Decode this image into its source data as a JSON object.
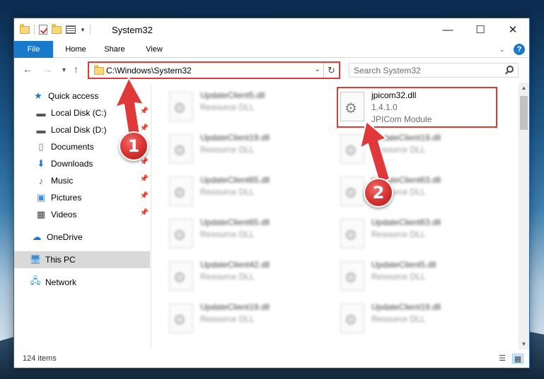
{
  "window": {
    "title": "System32",
    "controls": {
      "minimize": "—",
      "maximize": "☐",
      "close": "✕"
    }
  },
  "ribbon": {
    "tabs": [
      {
        "label": "File",
        "active": true
      },
      {
        "label": "Home"
      },
      {
        "label": "Share"
      },
      {
        "label": "View"
      }
    ],
    "help": "?"
  },
  "navigation": {
    "address": "C:\\Windows\\System32",
    "search_placeholder": "Search System32"
  },
  "sidebar": {
    "items": [
      {
        "label": "Quick access",
        "icon": "star-icon",
        "pinned": false
      },
      {
        "label": "Local Disk (C:)",
        "icon": "drive-icon",
        "pinned": true
      },
      {
        "label": "Local Disk (D:)",
        "icon": "drive-icon",
        "pinned": true
      },
      {
        "label": "Documents",
        "icon": "document-icon",
        "pinned": true
      },
      {
        "label": "Downloads",
        "icon": "download-icon",
        "pinned": true
      },
      {
        "label": "Music",
        "icon": "music-icon",
        "pinned": true
      },
      {
        "label": "Pictures",
        "icon": "pictures-icon",
        "pinned": true
      },
      {
        "label": "Videos",
        "icon": "video-icon",
        "pinned": true
      },
      {
        "label": "OneDrive",
        "icon": "cloud-icon",
        "pinned": false
      },
      {
        "label": "This PC",
        "icon": "computer-icon",
        "pinned": false,
        "selected": true
      },
      {
        "label": "Network",
        "icon": "network-icon",
        "pinned": false
      }
    ]
  },
  "files": {
    "col1": [
      {
        "name": "UpdateClient5.dll",
        "type": "Resource DLL"
      },
      {
        "name": "UpdateClient19.dll",
        "type": "Resource DLL"
      },
      {
        "name": "UpdateClient65.dll",
        "type": "Resource DLL"
      },
      {
        "name": "UpdateClient65.dll",
        "type": "Resource DLL"
      },
      {
        "name": "UpdateClient42.dll",
        "type": "Resource DLL"
      },
      {
        "name": "UpdateClient19.dll",
        "type": "Resource DLL"
      }
    ],
    "col2": [
      {
        "name": "jpicom32.dll",
        "version": "1.4.1.0",
        "type": "JPICom Module"
      },
      {
        "name": "UpdateClient19.dll",
        "type": "Resource DLL"
      },
      {
        "name": "UpdateClient63.dll",
        "type": "Resource DLL"
      },
      {
        "name": "UpdateClient63.dll",
        "type": "Resource DLL"
      },
      {
        "name": "UpdateClient5.dll",
        "type": "Resource DLL"
      },
      {
        "name": "UpdateClient19.dll",
        "type": "Resource DLL"
      }
    ]
  },
  "status": {
    "count": "124 items"
  },
  "annotations": {
    "badge1": "1",
    "badge2": "2",
    "color": "#e0393a"
  }
}
